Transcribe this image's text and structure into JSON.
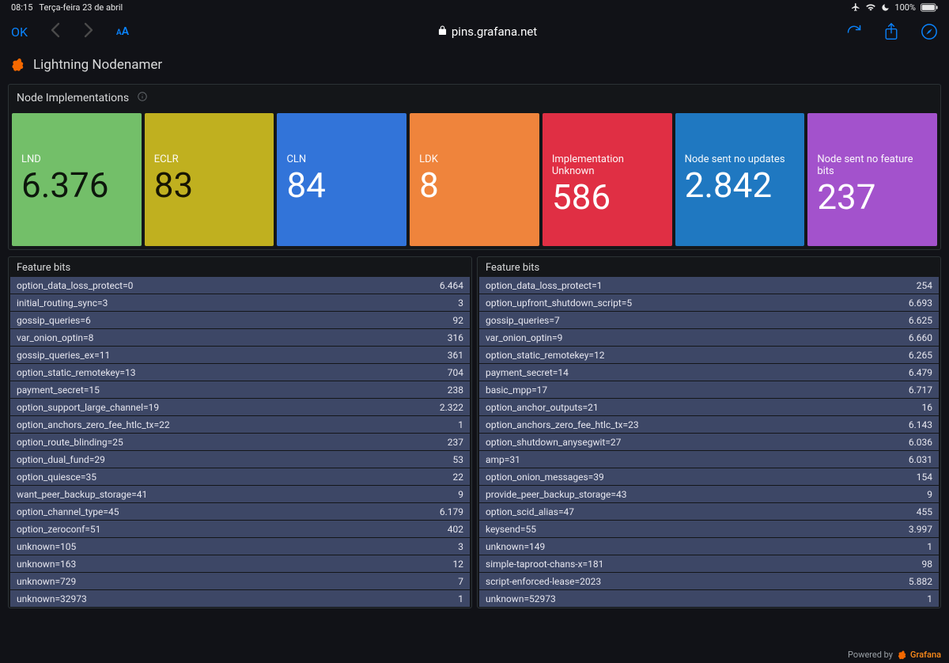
{
  "statusbar": {
    "time": "08:15",
    "date": "Terça-feira 23 de abril",
    "battery": "100%"
  },
  "browser": {
    "ok_label": "OK",
    "url_host": "pins.grafana.net"
  },
  "dashboard": {
    "title": "Lightning Nodenamer",
    "row_title": "Node Implementations",
    "stats": [
      {
        "label": "LND",
        "value": "6.376",
        "color": "c-green",
        "valclass": ""
      },
      {
        "label": "ECLR",
        "value": "83",
        "color": "c-yellow",
        "valclass": ""
      },
      {
        "label": "CLN",
        "value": "84",
        "color": "c-blue",
        "valclass": "light"
      },
      {
        "label": "LDK",
        "value": "8",
        "color": "c-orange",
        "valclass": "light"
      },
      {
        "label": "Implementation Unknown",
        "value": "586",
        "color": "c-red",
        "valclass": "light"
      },
      {
        "label": "Node sent no updates",
        "value": "2.842",
        "color": "c-cyan",
        "valclass": "light"
      },
      {
        "label": "Node sent no feature bits",
        "value": "237",
        "color": "c-purple",
        "valclass": "light"
      }
    ],
    "left_table": {
      "title": "Feature bits",
      "rows": [
        {
          "k": "option_data_loss_protect=0",
          "v": "6.464"
        },
        {
          "k": "initial_routing_sync=3",
          "v": "3"
        },
        {
          "k": "gossip_queries=6",
          "v": "92"
        },
        {
          "k": "var_onion_optin=8",
          "v": "316"
        },
        {
          "k": "gossip_queries_ex=11",
          "v": "361"
        },
        {
          "k": "option_static_remotekey=13",
          "v": "704"
        },
        {
          "k": "payment_secret=15",
          "v": "238"
        },
        {
          "k": "option_support_large_channel=19",
          "v": "2.322"
        },
        {
          "k": "option_anchors_zero_fee_htlc_tx=22",
          "v": "1"
        },
        {
          "k": "option_route_blinding=25",
          "v": "237"
        },
        {
          "k": "option_dual_fund=29",
          "v": "53"
        },
        {
          "k": "option_quiesce=35",
          "v": "22"
        },
        {
          "k": "want_peer_backup_storage=41",
          "v": "9"
        },
        {
          "k": "option_channel_type=45",
          "v": "6.179"
        },
        {
          "k": "option_zeroconf=51",
          "v": "402"
        },
        {
          "k": "unknown=105",
          "v": "3"
        },
        {
          "k": "unknown=163",
          "v": "12"
        },
        {
          "k": "unknown=729",
          "v": "7"
        },
        {
          "k": "unknown=32973",
          "v": "1"
        }
      ]
    },
    "right_table": {
      "title": "Feature bits",
      "rows": [
        {
          "k": "option_data_loss_protect=1",
          "v": "254"
        },
        {
          "k": "option_upfront_shutdown_script=5",
          "v": "6.693"
        },
        {
          "k": "gossip_queries=7",
          "v": "6.625"
        },
        {
          "k": "var_onion_optin=9",
          "v": "6.660"
        },
        {
          "k": "option_static_remotekey=12",
          "v": "6.265"
        },
        {
          "k": "payment_secret=14",
          "v": "6.479"
        },
        {
          "k": "basic_mpp=17",
          "v": "6.717"
        },
        {
          "k": "option_anchor_outputs=21",
          "v": "16"
        },
        {
          "k": "option_anchors_zero_fee_htlc_tx=23",
          "v": "6.143"
        },
        {
          "k": "option_shutdown_anysegwit=27",
          "v": "6.036"
        },
        {
          "k": "amp=31",
          "v": "6.031"
        },
        {
          "k": "option_onion_messages=39",
          "v": "154"
        },
        {
          "k": "provide_peer_backup_storage=43",
          "v": "9"
        },
        {
          "k": "option_scid_alias=47",
          "v": "455"
        },
        {
          "k": "keysend=55",
          "v": "3.997"
        },
        {
          "k": "unknown=149",
          "v": "1"
        },
        {
          "k": "simple-taproot-chans-x=181",
          "v": "98"
        },
        {
          "k": "script-enforced-lease=2023",
          "v": "5.882"
        },
        {
          "k": "unknown=52973",
          "v": "1"
        }
      ]
    }
  },
  "footer": {
    "powered_by": "Powered by",
    "brand": "Grafana"
  }
}
